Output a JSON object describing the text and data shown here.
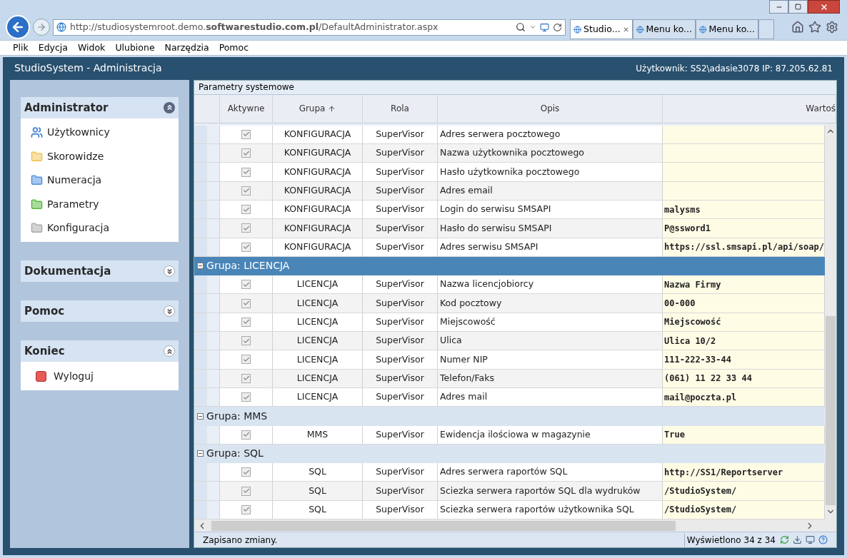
{
  "browser": {
    "address": "http://studiosystemroot.demo.**softwarestudio.com.pl**/DefaultAdministrator.aspx",
    "tabs": [
      {
        "label": "Studio...",
        "selected": true
      },
      {
        "label": "Menu ko...",
        "selected": false
      },
      {
        "label": "Menu ko...",
        "selected": false
      }
    ],
    "menu": [
      "Plik",
      "Edycja",
      "Widok",
      "Ulubione",
      "Narzędzia",
      "Pomoc"
    ]
  },
  "app": {
    "title": "StudioSystem - Administracja",
    "user_info": "Użytkownik: SS2\\adasie3078 IP: 87.205.62.81"
  },
  "sidebar": {
    "panels": [
      {
        "title": "Administrator",
        "expanded": true,
        "items": [
          {
            "label": "Użytkownicy",
            "kind": "users"
          },
          {
            "label": "Skorowidze",
            "kind": "folder-yellow"
          },
          {
            "label": "Numeracja",
            "kind": "folder-blue"
          },
          {
            "label": "Parametry",
            "kind": "folder-green"
          },
          {
            "label": "Konfiguracja",
            "kind": "folder-gray"
          }
        ]
      },
      {
        "title": "Dokumentacja",
        "expanded": false
      },
      {
        "title": "Pomoc",
        "expanded": false
      },
      {
        "title": "Koniec",
        "expanded": true,
        "items": [
          {
            "label": "Wyloguj",
            "kind": "logout"
          }
        ]
      }
    ]
  },
  "grid": {
    "title": "Parametry systemowe",
    "columns": [
      {
        "label": "Aktywne",
        "sorted": false
      },
      {
        "label": "Grupa",
        "sorted": true
      },
      {
        "label": "Rola",
        "sorted": false
      },
      {
        "label": "Opis",
        "sorted": false
      },
      {
        "label": "Wartoś",
        "sorted": false
      }
    ],
    "rows": [
      {
        "kind": "row",
        "active": true,
        "group": "KONFIGURACJA",
        "role": "SuperVisor",
        "description": "Adres serwera pocztowego"
      },
      {
        "kind": "row",
        "active": true,
        "group": "KONFIGURACJA",
        "role": "SuperVisor",
        "description": "Nazwa użytkownika pocztowego"
      },
      {
        "kind": "row",
        "active": true,
        "group": "KONFIGURACJA",
        "role": "SuperVisor",
        "description": "Hasło użytkownika pocztowego"
      },
      {
        "kind": "row",
        "active": true,
        "group": "KONFIGURACJA",
        "role": "SuperVisor",
        "description": "Adres email"
      },
      {
        "kind": "row",
        "active": true,
        "group": "KONFIGURACJA",
        "role": "SuperVisor",
        "description": "Login do serwisu SMSAPI",
        "value": "malysms"
      },
      {
        "kind": "row",
        "active": true,
        "group": "KONFIGURACJA",
        "role": "SuperVisor",
        "description": "Hasło do serwisu SMSAPI",
        "value": "P@ssword1"
      },
      {
        "kind": "row",
        "active": true,
        "group": "KONFIGURACJA",
        "role": "SuperVisor",
        "description": "Adres serwisu SMSAPI",
        "value": "https://ssl.smsapi.pl/api/soap/"
      },
      {
        "kind": "group",
        "label": "Grupa: LICENCJA",
        "expanded": true,
        "selected": true
      },
      {
        "kind": "row",
        "active": true,
        "group": "LICENCJA",
        "role": "SuperVisor",
        "description": "Nazwa licencjobiorcy",
        "value": "Nazwa Firmy"
      },
      {
        "kind": "row",
        "active": true,
        "group": "LICENCJA",
        "role": "SuperVisor",
        "description": "Kod pocztowy",
        "value": "00-000"
      },
      {
        "kind": "row",
        "active": true,
        "group": "LICENCJA",
        "role": "SuperVisor",
        "description": "Miejscowość",
        "value": "Miejscowość"
      },
      {
        "kind": "row",
        "active": true,
        "group": "LICENCJA",
        "role": "SuperVisor",
        "description": "Ulica",
        "value": "Ulica 10/2"
      },
      {
        "kind": "row",
        "active": true,
        "group": "LICENCJA",
        "role": "SuperVisor",
        "description": "Numer NIP",
        "value": "111-222-33-44"
      },
      {
        "kind": "row",
        "active": true,
        "group": "LICENCJA",
        "role": "SuperVisor",
        "description": "Telefon/Faks",
        "value": "(061) 11 22 33 44"
      },
      {
        "kind": "row",
        "active": true,
        "group": "LICENCJA",
        "role": "SuperVisor",
        "description": "Adres mail",
        "value": "mail@poczta.pl"
      },
      {
        "kind": "group",
        "label": "Grupa: MMS",
        "expanded": true,
        "selected": false
      },
      {
        "kind": "row",
        "active": true,
        "group": "MMS",
        "role": "SuperVisor",
        "description": "Ewidencja ilościowa w magazynie",
        "value": "True"
      },
      {
        "kind": "group",
        "label": "Grupa: SQL",
        "expanded": true,
        "selected": false
      },
      {
        "kind": "row",
        "active": true,
        "group": "SQL",
        "role": "SuperVisor",
        "description": "Adres serwera raportów SQL",
        "value": "http://SS1/Reportserver"
      },
      {
        "kind": "row",
        "active": true,
        "group": "SQL",
        "role": "SuperVisor",
        "description": "Sciezka serwera raportów SQL dla wydruków",
        "value": "/StudioSystem/"
      },
      {
        "kind": "row",
        "active": true,
        "group": "SQL",
        "role": "SuperVisor",
        "description": "Sciezka serwera raportów użytkownika SQL",
        "value": "/StudioSystem/"
      }
    ]
  },
  "status": {
    "message": "Zapisano zmiany.",
    "count": "Wyświetlono 34 z 34"
  }
}
